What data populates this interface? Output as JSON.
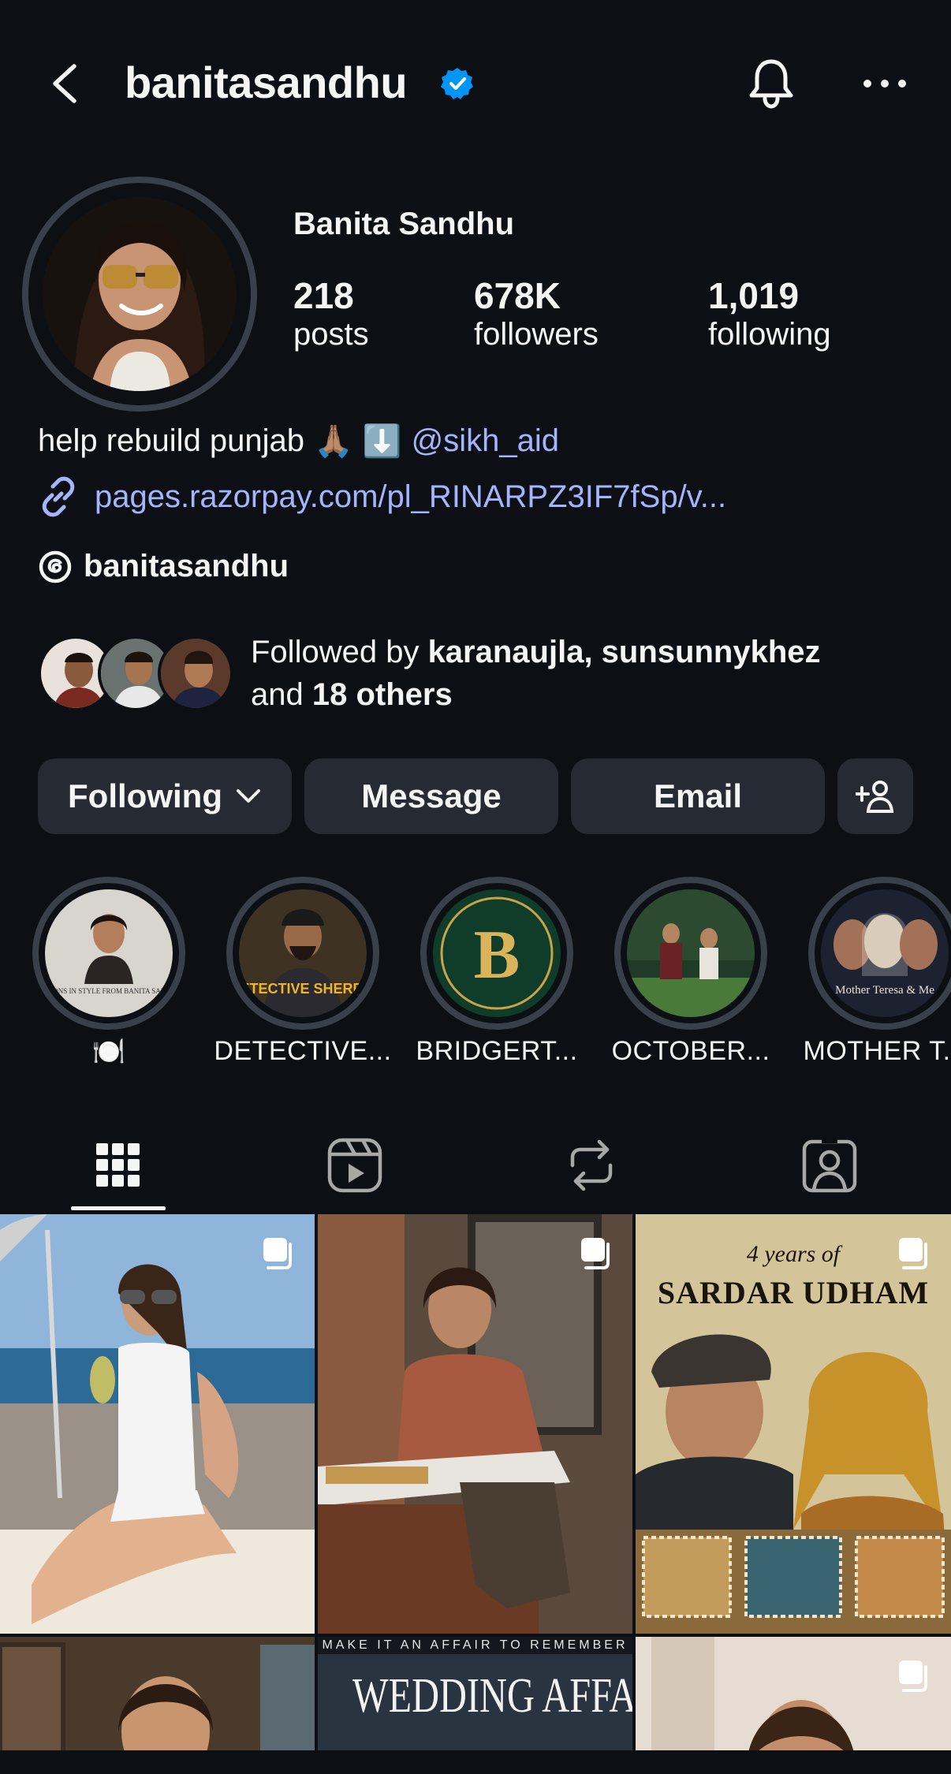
{
  "header": {
    "username": "banitasandhu"
  },
  "profile": {
    "full_name": "Banita Sandhu",
    "stats": [
      {
        "value": "218",
        "label": "posts"
      },
      {
        "value": "678K",
        "label": "followers"
      },
      {
        "value": "1,019",
        "label": "following"
      }
    ]
  },
  "bio": {
    "text": "help rebuild punjab",
    "emoji_1": "🙏🏽",
    "emoji_2": "⬇️",
    "mention": "@sikh_aid",
    "link": "pages.razorpay.com/pl_RINARPZ3IF7fSp/v...",
    "threads_handle": "banitasandhu"
  },
  "followed_by": {
    "prefix": "Followed by",
    "names": "karanaujla, sunsunnykhez",
    "and_text": "and",
    "others": "18 others"
  },
  "actions": {
    "following": "Following",
    "message": "Message",
    "email": "Email"
  },
  "highlights": [
    {
      "label": "🍽️"
    },
    {
      "label": "DETECTIVE..."
    },
    {
      "label": "BRIDGERT..."
    },
    {
      "label": "OCTOBER..."
    },
    {
      "label": "MOTHER T..."
    }
  ],
  "highlight_art": {
    "bridgerton_letter": "B",
    "detective_title": "DETECTIVE SHERDIL",
    "mother_title": "Mother Teresa & Me",
    "lessons_title": "LESSONS IN STYLE FROM BANITA SANDHU"
  },
  "grid": {
    "sardar_line1": "4 years of",
    "sardar_line2": "SARDAR UDHAM",
    "wedding_tagline": "MAKE IT AN AFFAIR TO REMEMBER",
    "wedding_title": "WEDDING AFFAIR"
  },
  "colors": {
    "background": "#0c1014",
    "button": "#262b33",
    "link": "#a5b4fc",
    "verified": "#0095f6"
  }
}
